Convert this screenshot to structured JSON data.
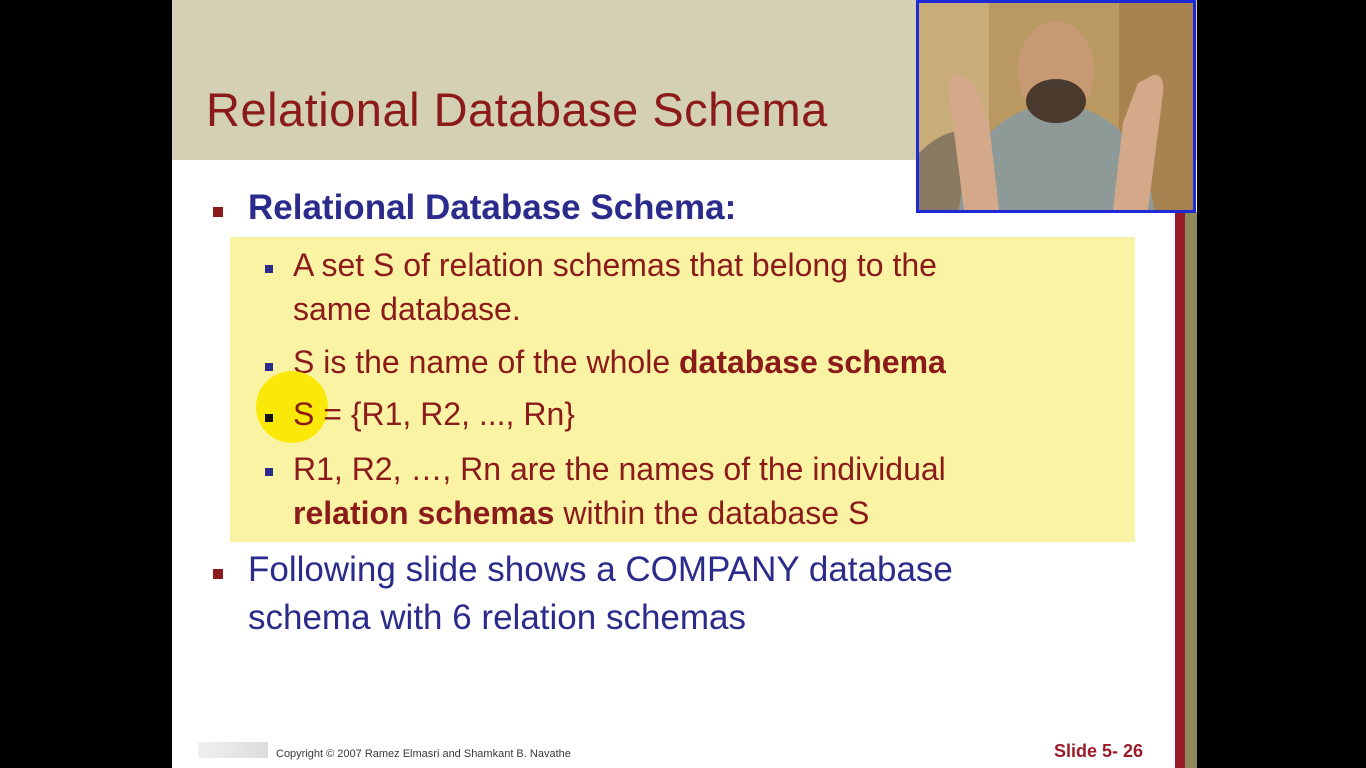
{
  "slide": {
    "title": "Relational Database Schema",
    "bullets": [
      {
        "text": "Relational Database Schema:"
      }
    ],
    "sub_bullets": [
      {
        "line1": "A set S of relation schemas that belong to the",
        "line2": "same database."
      },
      {
        "pre": "S is the name of the whole ",
        "bold": "database schema"
      },
      {
        "text": "S = {R1, R2, ..., Rn}"
      },
      {
        "line1": "R1, R2, …, Rn are the names of the individual",
        "bold": "relation schemas",
        "post": " within the database S"
      }
    ],
    "bullet2": {
      "line1": "Following slide shows a COMPANY database",
      "line2": "schema with 6 relation schemas"
    },
    "footer": {
      "copyright": "Copyright © 2007 Ramez Elmasri and Shamkant B. Navathe",
      "slide_number": "Slide 5- 26"
    }
  },
  "colors": {
    "title_band": "#d4d0b4",
    "title_text": "#8b1a1a",
    "level1_text": "#2b2b8c",
    "highlight_box": "#fbf3a4",
    "pointer": "#fae800",
    "webcam_border": "#1d2ad6"
  },
  "icons": [
    "bullet-square",
    "webcam-overlay",
    "pointer-highlight"
  ]
}
